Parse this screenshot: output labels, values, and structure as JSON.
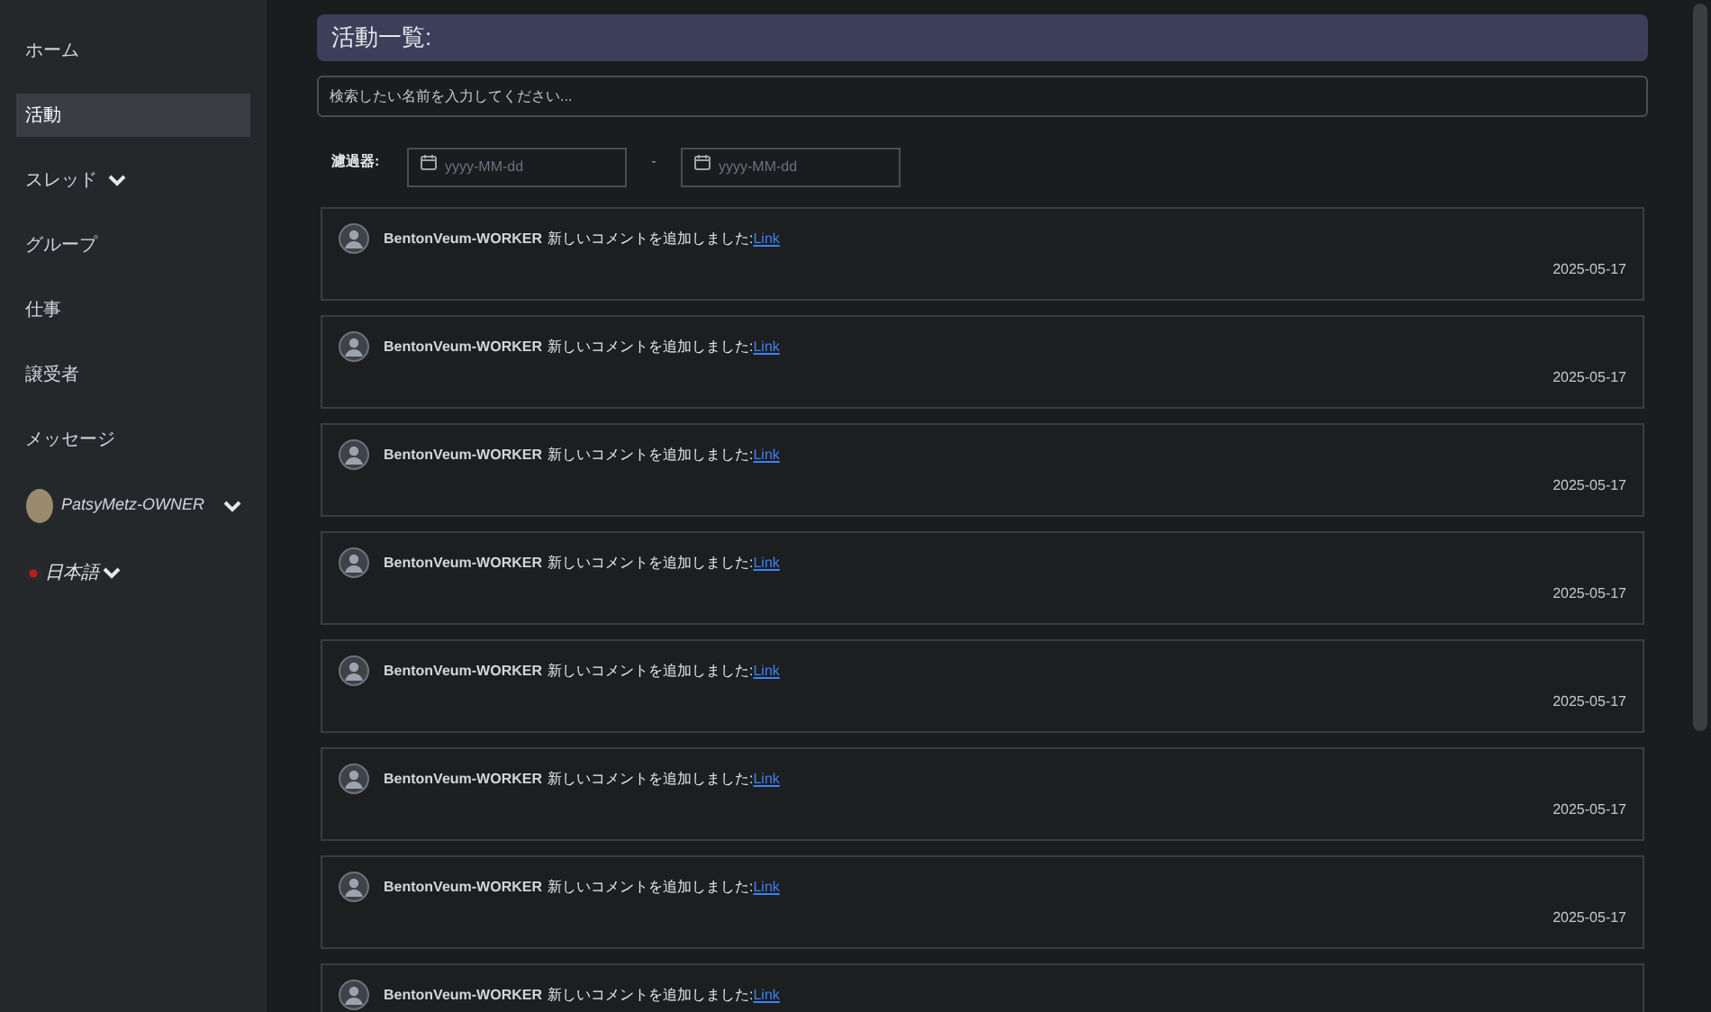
{
  "sidebar": {
    "items": [
      {
        "label": "ホーム",
        "selected": false,
        "kind": "link"
      },
      {
        "label": "活動",
        "selected": true,
        "kind": "link"
      },
      {
        "label": "スレッド",
        "selected": false,
        "kind": "dropdown"
      },
      {
        "label": "グループ",
        "selected": false,
        "kind": "link"
      },
      {
        "label": "仕事",
        "selected": false,
        "kind": "link"
      },
      {
        "label": "譲受者",
        "selected": false,
        "kind": "link"
      },
      {
        "label": "メッセージ",
        "selected": false,
        "kind": "link"
      }
    ],
    "user": {
      "name": "PatsyMetz-OWNER"
    },
    "language": {
      "label": "日本語"
    }
  },
  "header": {
    "title": "活動一覧:"
  },
  "search": {
    "placeholder": "検索したい名前を入力してください..."
  },
  "filter": {
    "label": "濾過器:",
    "from_placeholder": "yyyy-MM-dd",
    "separator": "-",
    "to_placeholder": "yyyy-MM-dd"
  },
  "activities": [
    {
      "user": "BentonVeum-WORKER",
      "message": "新しいコメントを追加しました:",
      "link": "Link",
      "date": "2025-05-17"
    },
    {
      "user": "BentonVeum-WORKER",
      "message": "新しいコメントを追加しました:",
      "link": "Link",
      "date": "2025-05-17"
    },
    {
      "user": "BentonVeum-WORKER",
      "message": "新しいコメントを追加しました:",
      "link": "Link",
      "date": "2025-05-17"
    },
    {
      "user": "BentonVeum-WORKER",
      "message": "新しいコメントを追加しました:",
      "link": "Link",
      "date": "2025-05-17"
    },
    {
      "user": "BentonVeum-WORKER",
      "message": "新しいコメントを追加しました:",
      "link": "Link",
      "date": "2025-05-17"
    },
    {
      "user": "BentonVeum-WORKER",
      "message": "新しいコメントを追加しました:",
      "link": "Link",
      "date": "2025-05-17"
    },
    {
      "user": "BentonVeum-WORKER",
      "message": "新しいコメントを追加しました:",
      "link": "Link",
      "date": "2025-05-17"
    },
    {
      "user": "BentonVeum-WORKER",
      "message": "新しいコメントを追加しました:",
      "link": "Link"
    }
  ]
}
